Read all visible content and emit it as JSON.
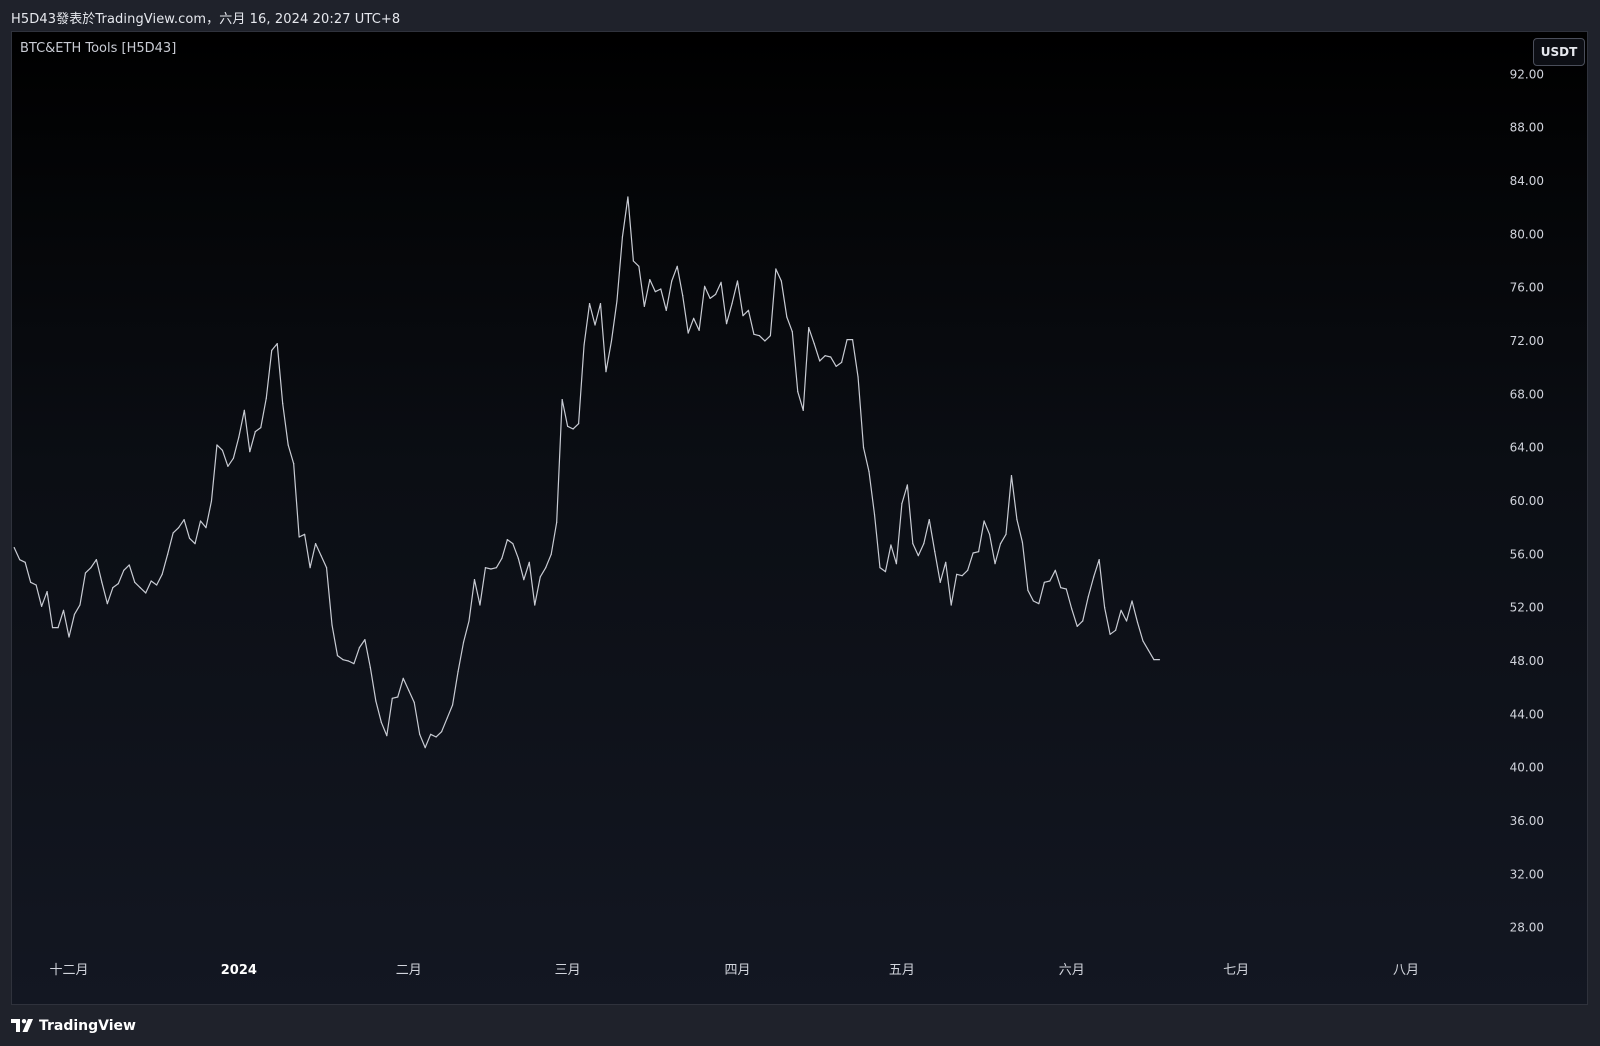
{
  "header": {
    "caption": "H5D43發表於TradingView.com，六月 16, 2024 20:27 UTC+8"
  },
  "indicator": {
    "title": "BTC&ETH Tools [H5D43]"
  },
  "currency_badge": "USDT",
  "footer": {
    "brand": "TradingView",
    "logo_icon": "tradingview-logo-icon"
  },
  "colors": {
    "line": "#c8cbd3",
    "axis_text": "#d1d4dc",
    "bold_tick": "#ffffff"
  },
  "chart_data": {
    "type": "line",
    "title": "",
    "xlabel": "",
    "ylabel": "",
    "ylim": [
      26,
      95
    ],
    "y_ticks": [
      "28.00",
      "32.00",
      "36.00",
      "40.00",
      "44.00",
      "48.00",
      "52.00",
      "56.00",
      "60.00",
      "64.00",
      "68.00",
      "72.00",
      "76.00",
      "80.00",
      "84.00",
      "88.00",
      "92.00"
    ],
    "x_tick_labels": [
      {
        "label": "十二月",
        "date": "2023-12-01",
        "bold": false
      },
      {
        "label": "2024",
        "date": "2024-01-01",
        "bold": true
      },
      {
        "label": "二月",
        "date": "2024-02-01",
        "bold": false
      },
      {
        "label": "三月",
        "date": "2024-03-01",
        "bold": false
      },
      {
        "label": "四月",
        "date": "2024-04-01",
        "bold": false
      },
      {
        "label": "五月",
        "date": "2024-05-01",
        "bold": false
      },
      {
        "label": "六月",
        "date": "2024-06-01",
        "bold": false
      },
      {
        "label": "七月",
        "date": "2024-07-01",
        "bold": false
      },
      {
        "label": "八月",
        "date": "2024-08-01",
        "bold": false
      }
    ],
    "series": [
      {
        "start_date": "2023-11-21",
        "values": [
          56.5,
          55.6,
          55.4,
          53.9,
          53.7,
          52.1,
          53.2,
          50.5,
          50.5,
          51.8,
          49.8,
          51.5,
          52.2,
          54.6,
          55.0,
          55.6,
          53.9,
          52.3,
          53.5,
          53.8,
          54.8,
          55.2,
          53.9,
          53.5,
          53.1,
          54.0,
          53.7,
          54.5,
          56.0,
          57.6,
          58.0,
          58.6,
          57.2,
          56.8,
          58.5,
          58.0,
          60.0,
          64.2,
          63.8,
          62.6,
          63.2,
          64.8,
          66.8,
          63.7,
          65.2,
          65.5,
          67.7,
          71.3,
          71.8,
          67.3,
          64.2,
          62.8,
          57.3,
          57.5,
          55.0,
          56.8,
          55.9,
          55.0,
          50.7,
          48.4,
          48.1,
          48.0,
          47.8,
          49.0,
          49.6,
          47.5,
          45.0,
          43.4,
          42.4,
          45.2,
          45.3,
          46.7,
          45.8,
          44.9,
          42.5,
          41.5,
          42.5,
          42.3,
          42.7,
          43.7,
          44.7,
          47.2,
          49.4,
          51.0,
          54.1,
          52.2,
          55.0,
          54.9,
          55.0,
          55.7,
          57.1,
          56.8,
          55.7,
          54.1,
          55.4,
          52.2,
          54.3,
          55.0,
          56.0,
          58.4,
          67.6,
          65.6,
          65.4,
          65.8,
          71.7,
          74.8,
          73.2,
          74.8,
          69.7,
          72.0,
          75.0,
          79.8,
          82.8,
          78.0,
          77.6,
          74.6,
          76.6,
          75.7,
          75.9,
          74.3,
          76.5,
          77.6,
          75.4,
          72.6,
          73.7,
          72.8,
          76.1,
          75.2,
          75.5,
          76.4,
          73.3,
          74.8,
          76.5,
          73.9,
          74.3,
          72.5,
          72.4,
          72.0,
          72.4,
          77.4,
          76.5,
          73.8,
          72.7,
          68.2,
          66.8,
          73.0,
          71.8,
          70.5,
          70.9,
          70.8,
          70.1,
          70.4,
          72.1,
          72.1,
          69.3,
          64.0,
          62.2,
          59.0,
          55.0,
          54.7,
          56.7,
          55.3,
          59.8,
          61.2,
          56.8,
          55.9,
          56.8,
          58.6,
          56.2,
          53.9,
          55.4,
          52.2,
          54.5,
          54.4,
          54.8,
          56.1,
          56.2,
          58.5,
          57.5,
          55.3,
          56.8,
          57.5,
          61.9,
          58.6,
          56.9,
          53.3,
          52.5,
          52.3,
          53.9,
          54.0,
          54.8,
          53.5,
          53.4,
          51.9,
          50.6,
          51.0,
          52.8,
          54.3,
          55.6,
          52.0,
          50.0,
          50.3,
          51.8,
          51.0,
          52.5,
          50.9,
          49.5,
          48.8,
          48.1,
          48.1
        ]
      }
    ],
    "grid": false,
    "legend": "none"
  }
}
